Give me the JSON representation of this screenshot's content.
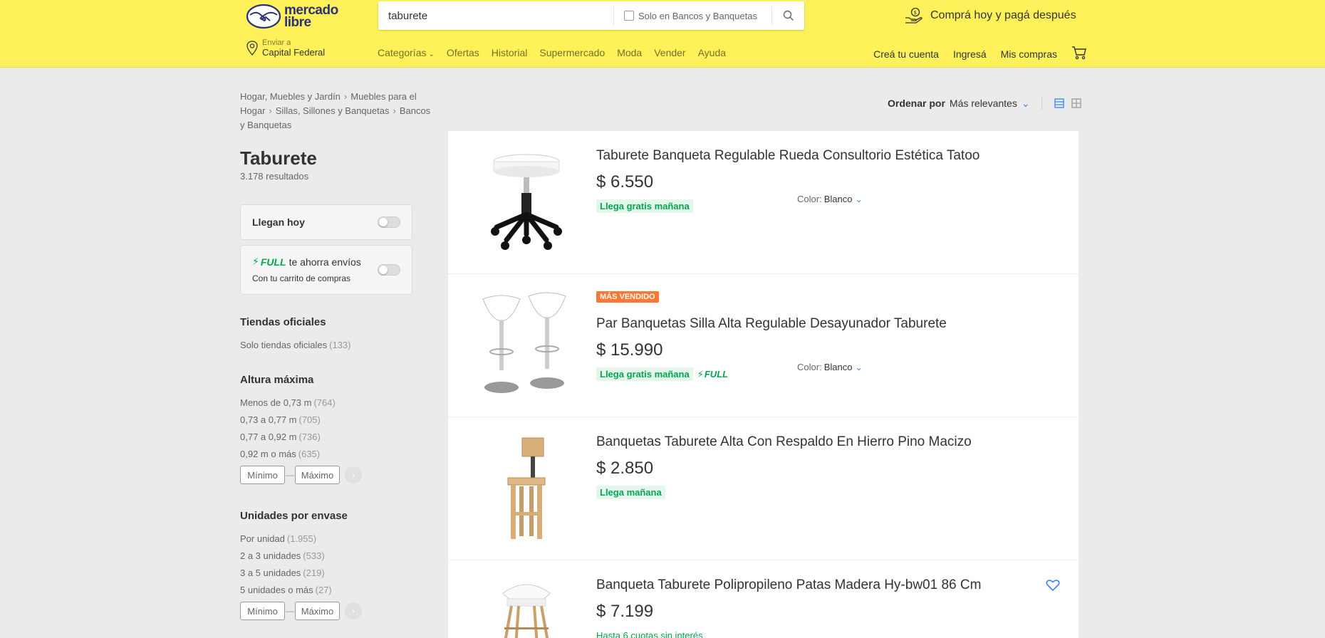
{
  "header": {
    "logo_line1": "mercado",
    "logo_line2": "libre",
    "search_value": "taburete",
    "filter_checkbox_label": "Solo en Bancos y Banquetas",
    "promo": "Comprá hoy y pagá después",
    "location_label": "Enviar a",
    "location_value": "Capital Federal",
    "nav": [
      "Categorías",
      "Ofertas",
      "Historial",
      "Supermercado",
      "Moda",
      "Vender",
      "Ayuda"
    ],
    "user_nav": [
      "Creá tu cuenta",
      "Ingresá",
      "Mis compras"
    ]
  },
  "breadcrumb": [
    "Hogar, Muebles y Jardín",
    "Muebles para el Hogar",
    "Sillas, Sillones y Banquetas",
    "Bancos y Banquetas"
  ],
  "page_title": "Taburete",
  "results_count": "3.178 resultados",
  "toggles": {
    "llegan_hoy": "Llegan hoy",
    "full_brand": "FULL",
    "full_text": "te ahorra envíos",
    "full_sub": "Con tu carrito de compras"
  },
  "filters": [
    {
      "title": "Tiendas oficiales",
      "options": [
        {
          "label": "Solo tiendas oficiales",
          "count": "(133)"
        }
      ]
    },
    {
      "title": "Altura máxima",
      "options": [
        {
          "label": "Menos de 0,73 m",
          "count": "(764)"
        },
        {
          "label": "0,73 a 0,77 m",
          "count": "(705)"
        },
        {
          "label": "0,77 a 0,92 m",
          "count": "(736)"
        },
        {
          "label": "0,92 m o más",
          "count": "(635)"
        }
      ],
      "range": {
        "min": "Mínimo",
        "max": "Máximo"
      }
    },
    {
      "title": "Unidades por envase",
      "options": [
        {
          "label": "Por unidad",
          "count": "(1.955)"
        },
        {
          "label": "2 a 3 unidades",
          "count": "(533)"
        },
        {
          "label": "3 a 5 unidades",
          "count": "(219)"
        },
        {
          "label": "5 unidades o más",
          "count": "(27)"
        }
      ],
      "range": {
        "min": "Mínimo",
        "max": "Máximo"
      }
    }
  ],
  "sort": {
    "label": "Ordenar por",
    "value": "Más relevantes"
  },
  "items": [
    {
      "title": "Taburete Banqueta Regulable Rueda Consultorio Estética Tatoo",
      "price": "$ 6.550",
      "shipping": "Llega gratis mañana",
      "color_label": "Color:",
      "color_value": "Blanco"
    },
    {
      "badge": "MÁS VENDIDO",
      "title": "Par Banquetas Silla Alta Regulable Desayunador Taburete",
      "price": "$ 15.990",
      "shipping": "Llega gratis mañana",
      "full": "FULL",
      "color_label": "Color:",
      "color_value": "Blanco"
    },
    {
      "title": "Banquetas Taburete Alta Con Respaldo En Hierro Pino Macizo",
      "price": "$ 2.850",
      "shipping": "Llega mañana"
    },
    {
      "title": "Banqueta Taburete Polipropileno Patas Madera Hy-bw01 86 Cm",
      "price": "$ 7.199",
      "installments": "Hasta 6 cuotas sin interés"
    }
  ],
  "colors": {
    "header_bg": "#fff159",
    "brand_blue": "#2d3277",
    "link_blue": "#3483fa",
    "green": "#00a650",
    "orange": "#ff7733"
  }
}
